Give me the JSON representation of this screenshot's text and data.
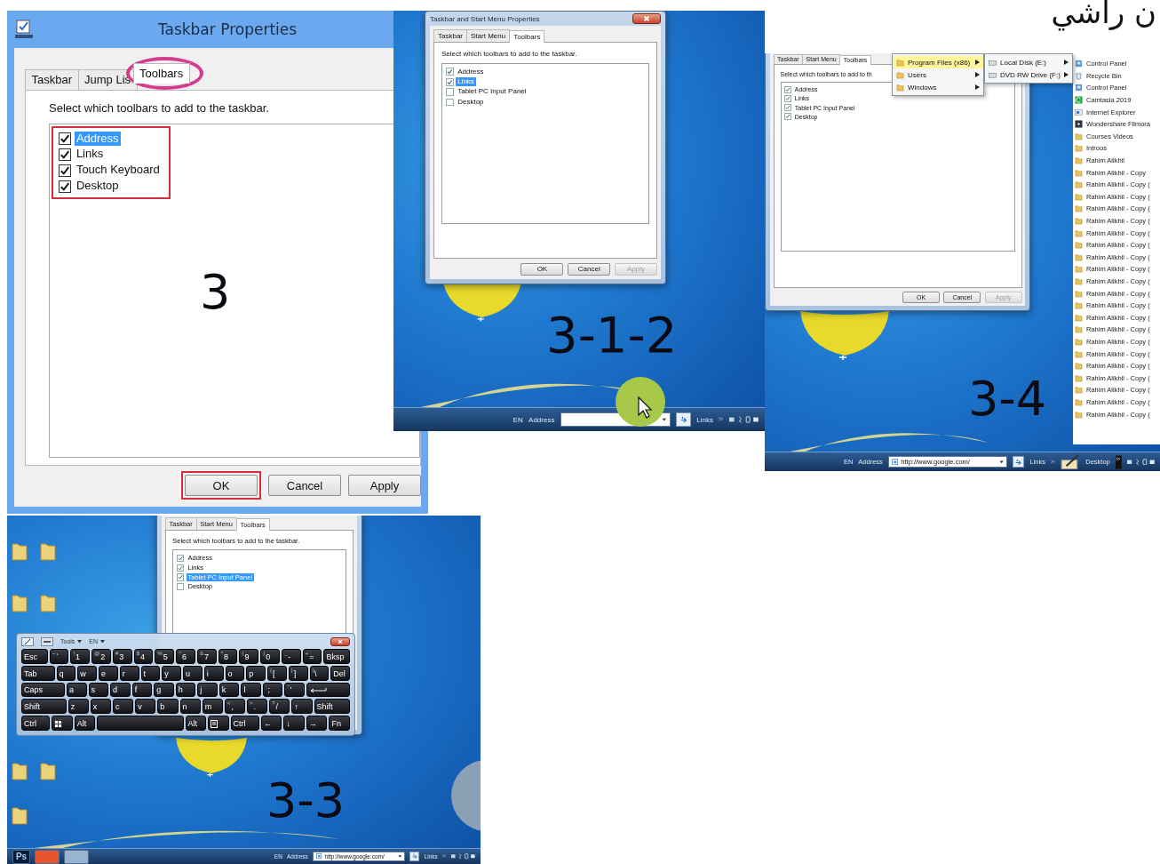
{
  "overlay_title": "ن راشي",
  "panels": [
    {
      "kind": "win8-dialog",
      "step": "3",
      "title": "Taskbar Properties",
      "tabs": [
        {
          "label": "Taskbar",
          "selected": false,
          "circled": false
        },
        {
          "label": "Jump Lis",
          "selected": false,
          "circled": false
        },
        {
          "label": "Toolbars",
          "selected": true,
          "circled": true
        }
      ],
      "description": "Select which toolbars to add to the taskbar.",
      "list_boxed": true,
      "toolbars": [
        {
          "label": "Address",
          "checked": true,
          "selected": true
        },
        {
          "label": "Links",
          "checked": true,
          "selected": false
        },
        {
          "label": "Touch Keyboard",
          "checked": true,
          "selected": false
        },
        {
          "label": "Desktop",
          "checked": true,
          "selected": false
        }
      ],
      "buttons": [
        {
          "label": "OK",
          "disabled": false,
          "boxed": true
        },
        {
          "label": "Cancel",
          "disabled": false,
          "boxed": false
        },
        {
          "label": "Apply",
          "disabled": false,
          "boxed": false
        }
      ]
    },
    {
      "kind": "win7-desktop",
      "step": "3-1-2",
      "dialog": {
        "title": "Taskbar and Start Menu Properties",
        "tabs": [
          {
            "label": "Taskbar",
            "selected": false
          },
          {
            "label": "Start Menu",
            "selected": false
          },
          {
            "label": "Toolbars",
            "selected": true
          }
        ],
        "description": "Select which toolbars to add to the taskbar.",
        "toolbars": [
          {
            "label": "Address",
            "checked": true,
            "selected": false
          },
          {
            "label": "Links",
            "checked": true,
            "selected": true
          },
          {
            "label": "Tablet PC Input Panel",
            "checked": false,
            "selected": false
          },
          {
            "label": "Desktop",
            "checked": false,
            "selected": false
          }
        ],
        "buttons": [
          {
            "label": "OK",
            "disabled": false
          },
          {
            "label": "Cancel",
            "disabled": false
          },
          {
            "label": "Apply",
            "disabled": true
          }
        ]
      },
      "taskbar": {
        "language": "EN",
        "address_label": "Address",
        "links_label": "Links"
      }
    },
    {
      "kind": "win7-menus",
      "step": "3-4",
      "dialog": {
        "tabs": [
          {
            "label": "Taskbar",
            "selected": false
          },
          {
            "label": "Start Menu",
            "selected": false
          },
          {
            "label": "Toolbars",
            "selected": true
          }
        ],
        "description": "Select which toolbars to add to th",
        "toolbars": [
          {
            "label": "Address",
            "checked": true,
            "selected": false
          },
          {
            "label": "Links",
            "checked": true,
            "selected": false
          },
          {
            "label": "Tablet PC Input Panel",
            "checked": true,
            "selected": false
          },
          {
            "label": "Desktop",
            "checked": true,
            "selected": false
          }
        ],
        "buttons": [
          {
            "label": "OK",
            "disabled": false
          },
          {
            "label": "Cancel",
            "disabled": false
          },
          {
            "label": "Apply",
            "disabled": true
          }
        ]
      },
      "menu": [
        {
          "label": "Program Files (x86)",
          "has_submenu": true,
          "hovered": true
        },
        {
          "label": "Users",
          "has_submenu": true,
          "hovered": false
        },
        {
          "label": "Windows",
          "has_submenu": true,
          "hovered": false
        }
      ],
      "submenu": [
        {
          "label": "Local Disk (E:)",
          "has_submenu": true
        },
        {
          "label": "DVD RW Drive (F:)",
          "has_submenu": true
        }
      ],
      "desktop_list": [
        {
          "label": "Control Panel",
          "kind": "settings"
        },
        {
          "label": "Recycle Bin",
          "kind": "bin"
        },
        {
          "label": "Control Panel",
          "kind": "settings"
        },
        {
          "label": "Camtasia 2019",
          "kind": "app"
        },
        {
          "label": "Internet Explorer",
          "kind": "browser"
        },
        {
          "label": "Wondershare Filmora",
          "kind": "player"
        },
        {
          "label": "Courses Videos",
          "kind": "folder"
        },
        {
          "label": "Introos",
          "kind": "folder"
        },
        {
          "label": "Rahim Alikhil",
          "kind": "folder"
        },
        {
          "label": "Rahim Alikhil - Copy",
          "kind": "folder"
        },
        {
          "label": "Rahim Alikhil - Copy (",
          "kind": "folder"
        },
        {
          "label": "Rahim Alikhil - Copy (",
          "kind": "folder"
        },
        {
          "label": "Rahim Alikhil - Copy (",
          "kind": "folder"
        },
        {
          "label": "Rahim Alikhil - Copy (",
          "kind": "folder"
        },
        {
          "label": "Rahim Alikhil - Copy (",
          "kind": "folder"
        },
        {
          "label": "Rahim Alikhil - Copy (",
          "kind": "folder"
        },
        {
          "label": "Rahim Alikhil - Copy (",
          "kind": "folder"
        },
        {
          "label": "Rahim Alikhil - Copy (",
          "kind": "folder"
        },
        {
          "label": "Rahim Alikhil - Copy (",
          "kind": "folder"
        },
        {
          "label": "Rahim Alikhil - Copy (",
          "kind": "folder"
        },
        {
          "label": "Rahim Alikhil - Copy (",
          "kind": "folder"
        },
        {
          "label": "Rahim Alikhil - Copy (",
          "kind": "folder"
        },
        {
          "label": "Rahim Alikhil - Copy (",
          "kind": "folder"
        },
        {
          "label": "Rahim Alikhil - Copy (",
          "kind": "folder"
        },
        {
          "label": "Rahim Alikhil - Copy (",
          "kind": "folder"
        },
        {
          "label": "Rahim Alikhil - Copy (",
          "kind": "folder"
        },
        {
          "label": "Rahim Alikhil - Copy (",
          "kind": "folder"
        },
        {
          "label": "Rahim Alikhil - Copy (",
          "kind": "folder"
        },
        {
          "label": "Rahim Alikhil - Copy (",
          "kind": "folder"
        },
        {
          "label": "Rahim Alikhil - Copy (",
          "kind": "folder"
        }
      ],
      "taskbar": {
        "language": "EN",
        "address_label": "Address",
        "address_value": "http://www.google.com/",
        "links_label": "Links",
        "desktop_label": "Desktop"
      }
    },
    {
      "kind": "win7-keyboard",
      "step": "3-3",
      "dialog": {
        "tabs": [
          {
            "label": "Taskbar",
            "selected": false
          },
          {
            "label": "Start Menu",
            "selected": false
          },
          {
            "label": "Toolbars",
            "selected": true
          }
        ],
        "description": "Select which toolbars to add to the taskbar.",
        "toolbars": [
          {
            "label": "Address",
            "checked": true,
            "selected": false
          },
          {
            "label": "Links",
            "checked": true,
            "selected": false
          },
          {
            "label": "Tablet PC Input Panel",
            "checked": true,
            "selected": true
          },
          {
            "label": "Desktop",
            "checked": false,
            "selected": false
          }
        ]
      },
      "keyboard": {
        "tools_menu": "Tools",
        "language_menu": "EN",
        "rows": [
          {
            "keys": [
              {
                "main": "Esc",
                "kind": "mod"
              },
              {
                "main": "`",
                "shift": "~",
                "kind": "key"
              },
              {
                "main": "1",
                "shift": "!",
                "kind": "key"
              },
              {
                "main": "2",
                "shift": "@",
                "kind": "key"
              },
              {
                "main": "3",
                "shift": "#",
                "kind": "key"
              },
              {
                "main": "4",
                "shift": "$",
                "kind": "key"
              },
              {
                "main": "5",
                "shift": "%",
                "kind": "key"
              },
              {
                "main": "6",
                "shift": "^",
                "kind": "key"
              },
              {
                "main": "7",
                "shift": "&",
                "kind": "key"
              },
              {
                "main": "8",
                "shift": "*",
                "kind": "key"
              },
              {
                "main": "9",
                "shift": "(",
                "kind": "key"
              },
              {
                "main": "0",
                "shift": ")",
                "kind": "key"
              },
              {
                "main": "-",
                "shift": "_",
                "kind": "key"
              },
              {
                "main": "=",
                "shift": "+",
                "kind": "key"
              },
              {
                "main": "Bksp",
                "kind": "mod"
              }
            ]
          },
          {
            "keys": [
              {
                "main": "Tab",
                "kind": "mod2"
              },
              {
                "main": "q",
                "kind": "key"
              },
              {
                "main": "w",
                "kind": "key"
              },
              {
                "main": "e",
                "kind": "key"
              },
              {
                "main": "r",
                "kind": "key"
              },
              {
                "main": "t",
                "kind": "key"
              },
              {
                "main": "y",
                "kind": "key"
              },
              {
                "main": "u",
                "kind": "key"
              },
              {
                "main": "i",
                "kind": "key"
              },
              {
                "main": "o",
                "kind": "key"
              },
              {
                "main": "p",
                "kind": "key"
              },
              {
                "main": "[",
                "shift": "{",
                "kind": "key"
              },
              {
                "main": "]",
                "shift": "}",
                "kind": "key"
              },
              {
                "main": "\\",
                "shift": "|",
                "kind": "key"
              },
              {
                "main": "Del",
                "kind": "key"
              }
            ]
          },
          {
            "keys": [
              {
                "main": "Caps",
                "kind": "mod3"
              },
              {
                "main": "a",
                "kind": "key"
              },
              {
                "main": "s",
                "kind": "key"
              },
              {
                "main": "d",
                "kind": "key"
              },
              {
                "main": "f",
                "kind": "key"
              },
              {
                "main": "g",
                "kind": "key"
              },
              {
                "main": "h",
                "kind": "key"
              },
              {
                "main": "j",
                "kind": "key"
              },
              {
                "main": "k",
                "kind": "key"
              },
              {
                "main": "l",
                "kind": "key"
              },
              {
                "main": ";",
                "shift": ":",
                "kind": "key"
              },
              {
                "main": "'",
                "shift": "\"",
                "kind": "key"
              },
              {
                "kind": "enter"
              }
            ]
          },
          {
            "keys": [
              {
                "main": "Shift",
                "kind": "mod3"
              },
              {
                "main": "z",
                "kind": "key"
              },
              {
                "main": "x",
                "kind": "key"
              },
              {
                "main": "c",
                "kind": "key"
              },
              {
                "main": "v",
                "kind": "key"
              },
              {
                "main": "b",
                "kind": "key"
              },
              {
                "main": "n",
                "kind": "key"
              },
              {
                "main": "m",
                "kind": "key"
              },
              {
                "main": ",",
                "shift": "<",
                "kind": "key"
              },
              {
                "main": ".",
                "shift": ">",
                "kind": "key"
              },
              {
                "main": "/",
                "shift": "?",
                "kind": "key"
              },
              {
                "main": "↑",
                "kind": "key"
              },
              {
                "main": "Shift",
                "kind": "mod2"
              }
            ]
          },
          {
            "keys": [
              {
                "main": "Ctrl",
                "kind": "mod"
              },
              {
                "kind": "win"
              },
              {
                "main": "Alt",
                "kind": "key"
              },
              {
                "kind": "space"
              },
              {
                "main": "Alt",
                "kind": "key"
              },
              {
                "kind": "menu"
              },
              {
                "main": "Ctrl",
                "kind": "mod"
              },
              {
                "main": "←",
                "kind": "key"
              },
              {
                "main": "↓",
                "kind": "key"
              },
              {
                "main": "→",
                "kind": "key"
              },
              {
                "main": "Fn",
                "kind": "key"
              }
            ]
          }
        ]
      },
      "taskbar": {
        "pinned_apps": [
          {
            "kind": "photoshop",
            "label": "Ps"
          },
          {
            "kind": "camtasia"
          },
          {
            "kind": "files"
          }
        ],
        "language": "EN",
        "address_label": "Address",
        "address_value": "http://www.google.com/",
        "links_label": "Links"
      }
    }
  ]
}
